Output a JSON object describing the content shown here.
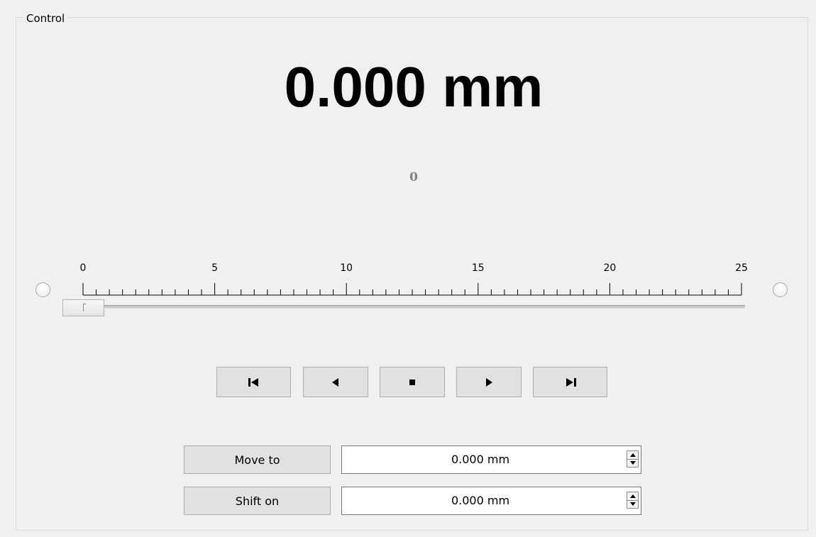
{
  "group": {
    "title": "Control"
  },
  "position": {
    "display": "0.000 mm",
    "raw_value": "0"
  },
  "slider": {
    "min": 0,
    "max": 25,
    "value": 0,
    "tick_labels": [
      "0",
      "5",
      "10",
      "15",
      "20",
      "25"
    ]
  },
  "media_buttons": [
    {
      "name": "skip-to-start",
      "icon": "skip-to-start-icon"
    },
    {
      "name": "step-backward",
      "icon": "play-reverse-icon"
    },
    {
      "name": "stop",
      "icon": "stop-icon"
    },
    {
      "name": "step-forward",
      "icon": "play-icon"
    },
    {
      "name": "skip-to-end",
      "icon": "skip-to-end-icon"
    }
  ],
  "move_to": {
    "label": "Move to",
    "value": "0.000 mm"
  },
  "shift_on": {
    "label": "Shift on",
    "value": "0.000 mm"
  },
  "colors": {
    "background": "#f0f0f0",
    "button_face": "#e1e1e1",
    "button_border": "#adadad",
    "raw_value_text": "#808080"
  }
}
